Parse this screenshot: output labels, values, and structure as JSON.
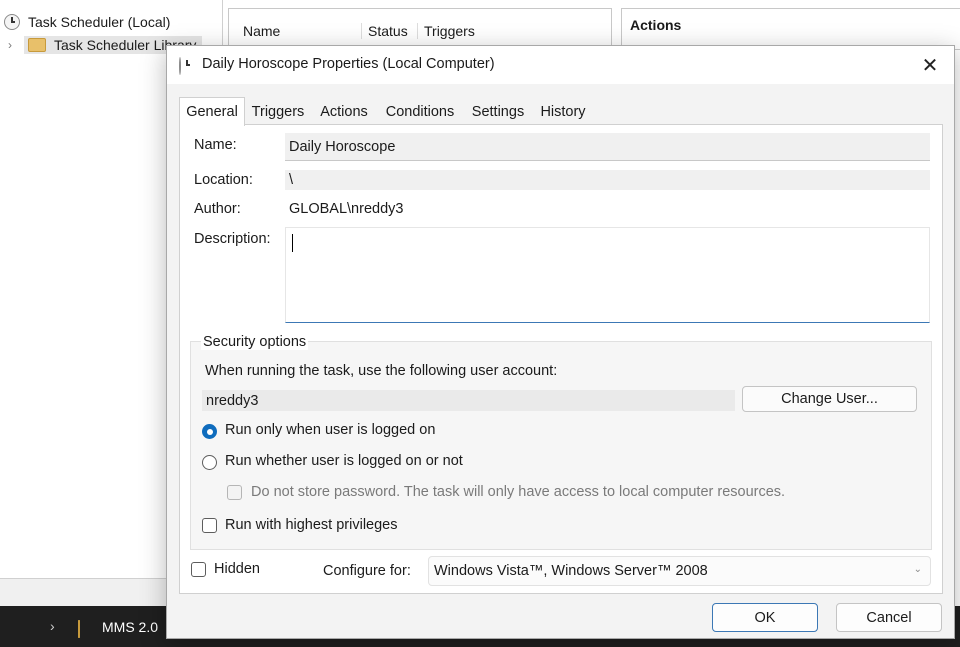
{
  "background": {
    "tree": {
      "root_label": "Task Scheduler (Local)",
      "library_label": "Task Scheduler Library"
    },
    "list_columns": [
      "Name",
      "Status",
      "Triggers"
    ],
    "actions_title": "Actions"
  },
  "taskbar": {
    "item_label": "MMS 2.0"
  },
  "dialog": {
    "title": "Daily Horoscope Properties (Local Computer)",
    "tabs": [
      {
        "label": "General",
        "active": true
      },
      {
        "label": "Triggers",
        "active": false
      },
      {
        "label": "Actions",
        "active": false
      },
      {
        "label": "Conditions",
        "active": false
      },
      {
        "label": "Settings",
        "active": false
      },
      {
        "label": "History",
        "active": false
      }
    ],
    "general": {
      "name_label": "Name:",
      "name_value": "Daily Horoscope",
      "location_label": "Location:",
      "location_value": "\\",
      "author_label": "Author:",
      "author_value": "GLOBAL\\nreddy3",
      "description_label": "Description:",
      "description_value": ""
    },
    "security": {
      "group_title": "Security options",
      "account_prompt": "When running the task, use the following user account:",
      "account_value": "nreddy3",
      "change_user_label": "Change User...",
      "radio_logged_on": "Run only when user is logged on",
      "radio_logged_on_checked": true,
      "radio_whether": "Run whether user is logged on or not",
      "radio_whether_checked": false,
      "no_store_password": "Do not store password.  The task will only have access to local computer resources.",
      "highest_privileges": "Run with highest privileges"
    },
    "footer": {
      "hidden_label": "Hidden",
      "configure_label": "Configure for:",
      "configure_value": "Windows Vista™, Windows Server™ 2008",
      "ok_label": "OK",
      "cancel_label": "Cancel"
    },
    "colors": {
      "accent": "#0f6cbd",
      "focus_border": "#3c78b5"
    }
  }
}
